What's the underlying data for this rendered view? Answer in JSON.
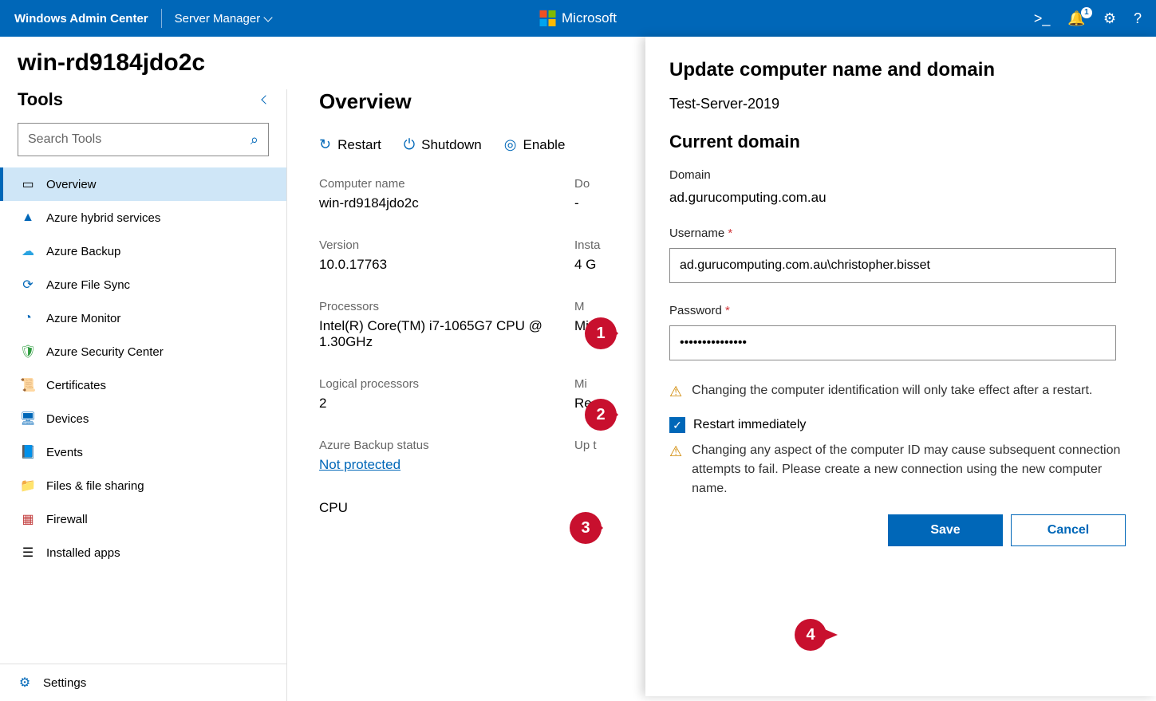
{
  "header": {
    "brand": "Windows Admin Center",
    "context": "Server Manager",
    "ms": "Microsoft",
    "notif_count": "1"
  },
  "server_name": "win-rd9184jdo2c",
  "tools": {
    "title": "Tools",
    "search_placeholder": "Search Tools",
    "items": [
      {
        "label": "Overview"
      },
      {
        "label": "Azure hybrid services"
      },
      {
        "label": "Azure Backup"
      },
      {
        "label": "Azure File Sync"
      },
      {
        "label": "Azure Monitor"
      },
      {
        "label": "Azure Security Center"
      },
      {
        "label": "Certificates"
      },
      {
        "label": "Devices"
      },
      {
        "label": "Events"
      },
      {
        "label": "Files & file sharing"
      },
      {
        "label": "Firewall"
      },
      {
        "label": "Installed apps"
      }
    ],
    "settings": "Settings"
  },
  "overview": {
    "title": "Overview",
    "actions": {
      "restart": "Restart",
      "shutdown": "Shutdown",
      "enable": "Enable"
    },
    "fields": {
      "computer_name_lbl": "Computer name",
      "computer_name_val": "win-rd9184jdo2c",
      "domain_lbl_short": "Do",
      "domain_val_short": "-",
      "version_lbl": "Version",
      "version_val": "10.0.17763",
      "installed_lbl": "Insta",
      "installed_val": "4 G",
      "processors_lbl": "Processors",
      "processors_val": "Intel(R) Core(TM) i7-1065G7 CPU @ 1.30GHz",
      "m_lbl": "M",
      "m_val": "Mic",
      "logical_lbl": "Logical processors",
      "logical_val": "2",
      "mi_lbl": "Mi",
      "mi_val": "Rea",
      "azure_lbl": "Azure Backup status",
      "azure_val": "Not protected",
      "up_lbl": "Up t",
      "cpu_lbl": "CPU"
    }
  },
  "flyout": {
    "title": "Update computer name and domain",
    "new_name": "Test-Server-2019",
    "section": "Current domain",
    "domain_lbl": "Domain",
    "domain_val": "ad.gurucomputing.com.au",
    "user_lbl": "Username",
    "user_val": "ad.gurucomputing.com.au\\christopher.bisset",
    "pass_lbl": "Password",
    "pass_val": "•••••••••••••••",
    "warn1": "Changing the computer identification will only take effect after a restart.",
    "restart_chk": "Restart immediately",
    "warn2": "Changing any aspect of the computer ID may cause subsequent connection attempts to fail. Please create a new connection using the new computer name.",
    "save": "Save",
    "cancel": "Cancel"
  },
  "annotations": {
    "a1": "1",
    "a2": "2",
    "a3": "3",
    "a4": "4"
  }
}
